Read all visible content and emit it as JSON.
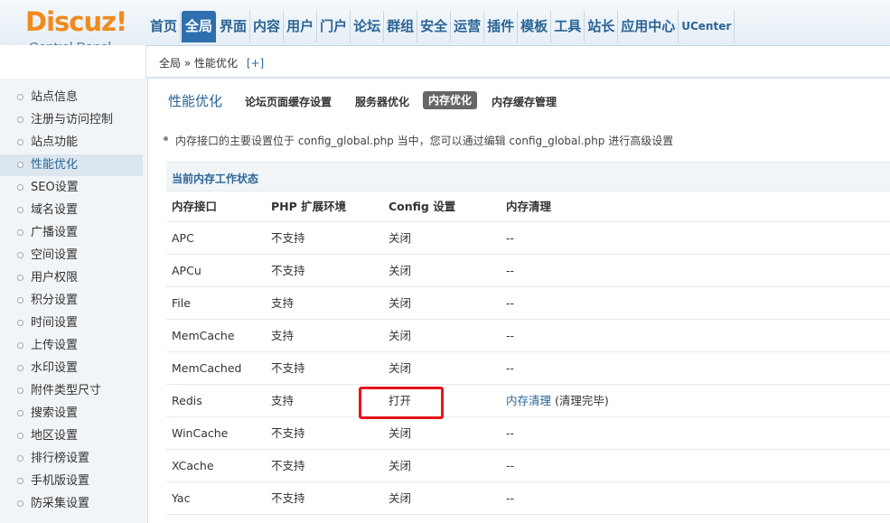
{
  "logo": {
    "word": "Discuz!",
    "sub": "Control Panel"
  },
  "nav": [
    "首页",
    "全局",
    "界面",
    "内容",
    "用户",
    "门户",
    "论坛",
    "群组",
    "安全",
    "运营",
    "插件",
    "模板",
    "工具",
    "站长",
    "应用中心",
    "UCenter"
  ],
  "nav_active": "全局",
  "breadcrumb": {
    "text": "全局 » 性能优化",
    "plus": "[+]"
  },
  "sidebar": [
    "站点信息",
    "注册与访问控制",
    "站点功能",
    "性能优化",
    "SEO设置",
    "域名设置",
    "广播设置",
    "空间设置",
    "用户权限",
    "积分设置",
    "时间设置",
    "上传设置",
    "水印设置",
    "附件类型尺寸",
    "搜索设置",
    "地区设置",
    "排行榜设置",
    "手机版设置",
    "防采集设置"
  ],
  "sidebar_active": "性能优化",
  "main": {
    "title": "性能优化",
    "tabs": [
      "论坛页面缓存设置",
      "服务器优化",
      "内存优化",
      "内存缓存管理"
    ],
    "active_tab": "内存优化",
    "tip": "内存接口的主要设置位于 config_global.php 当中，您可以通过编辑 config_global.php 进行高级设置",
    "section_title": "当前内存工作状态",
    "table": {
      "headers": [
        "内存接口",
        "PHP 扩展环境",
        "Config 设置",
        "内存清理"
      ],
      "rows": [
        [
          "APC",
          "不支持",
          "关闭",
          "--"
        ],
        [
          "APCu",
          "不支持",
          "关闭",
          "--"
        ],
        [
          "File",
          "支持",
          "关闭",
          "--"
        ],
        [
          "MemCache",
          "支持",
          "关闭",
          "--"
        ],
        [
          "MemCached",
          "不支持",
          "关闭",
          "--"
        ],
        [
          "Redis",
          "支持",
          "打开",
          "内存清理"
        ],
        [
          "WinCache",
          "不支持",
          "关闭",
          "--"
        ],
        [
          "XCache",
          "不支持",
          "关闭",
          "--"
        ],
        [
          "Yac",
          "不支持",
          "关闭",
          "--"
        ]
      ],
      "redis_note": " (清理完毕)"
    }
  },
  "colors": {
    "accent": "#2b6496",
    "logo": "#f08a1c",
    "highlight": "#e6111b"
  }
}
